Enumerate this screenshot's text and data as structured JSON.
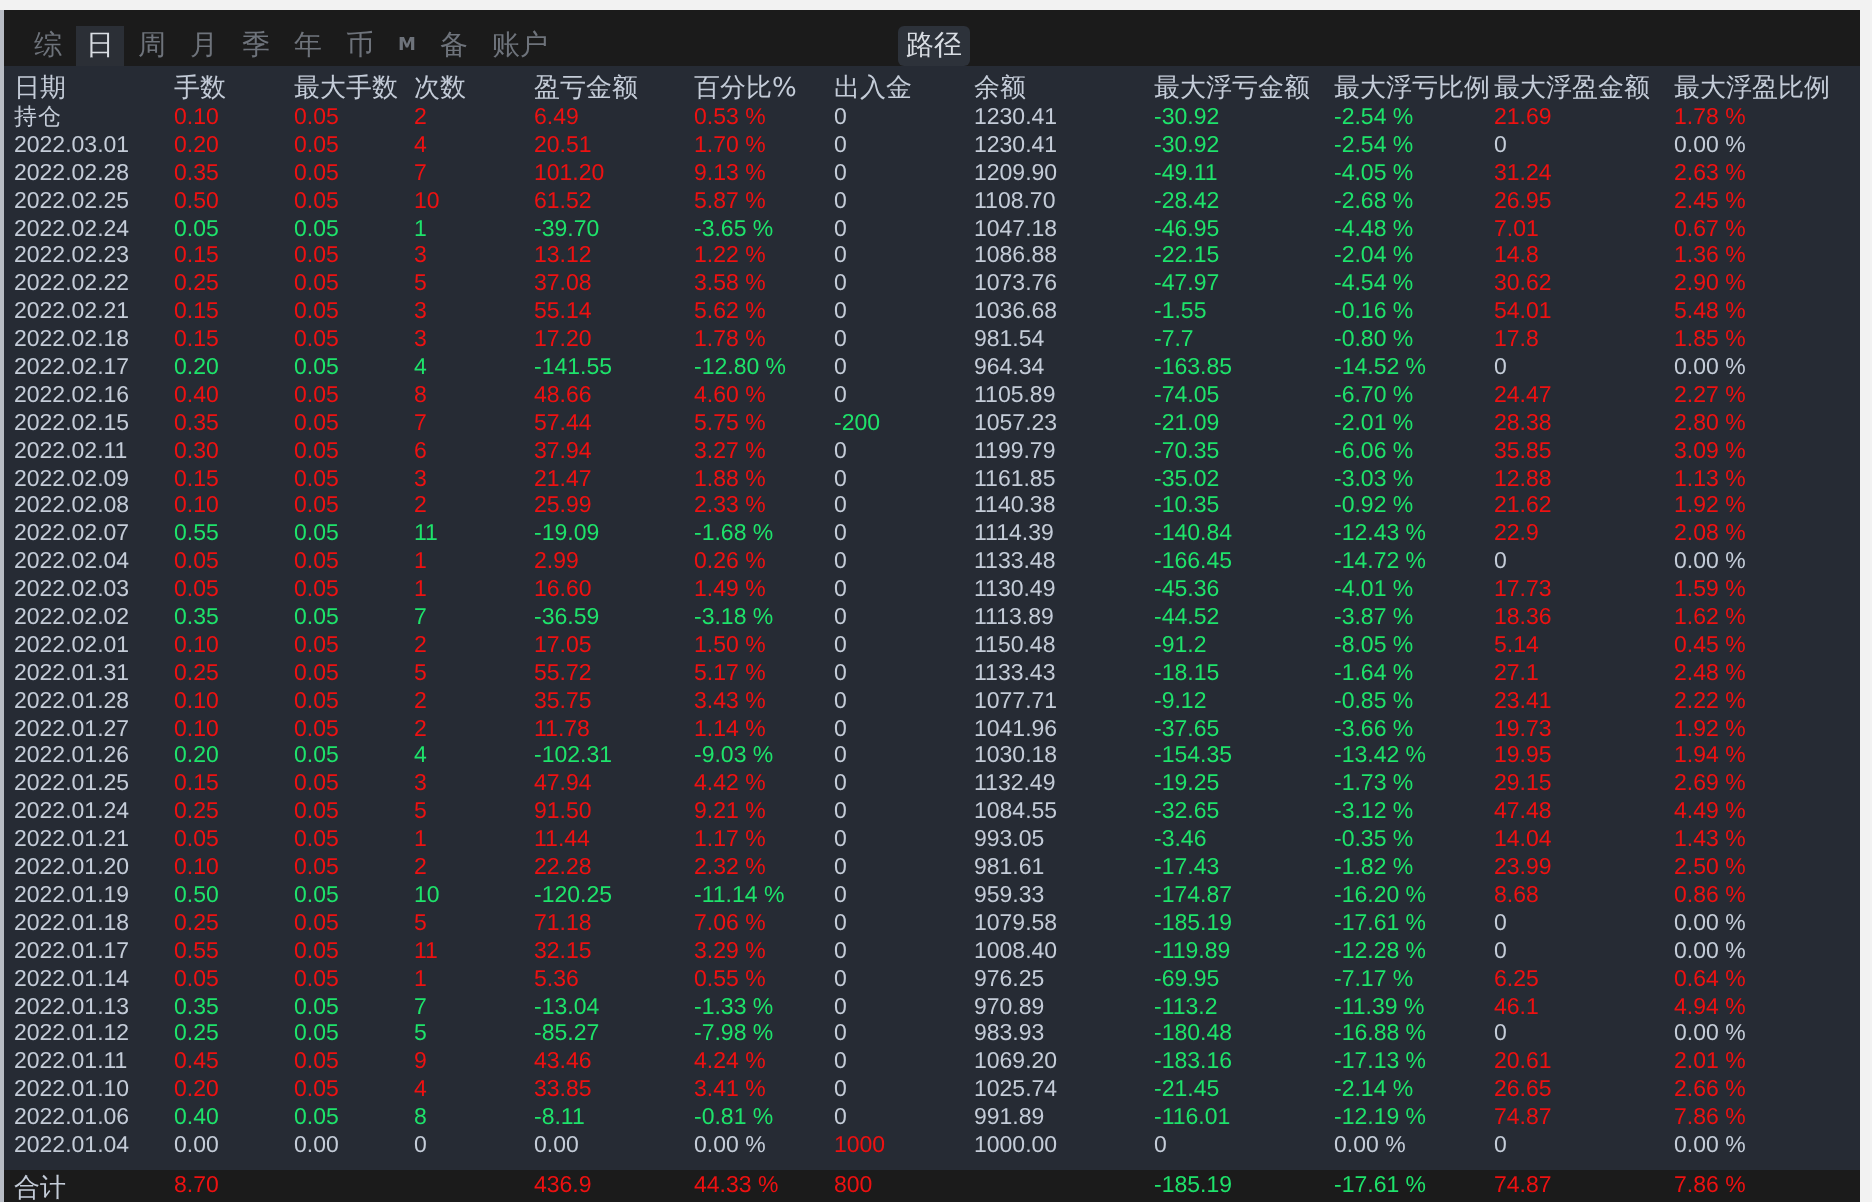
{
  "tabs": [
    {
      "label": "综",
      "selected": false
    },
    {
      "label": "日",
      "selected": true
    },
    {
      "label": "周",
      "selected": false
    },
    {
      "label": "月",
      "selected": false
    },
    {
      "label": "季",
      "selected": false
    },
    {
      "label": "年",
      "selected": false
    },
    {
      "label": "币",
      "selected": false
    },
    {
      "label": "M",
      "selected": false,
      "kind": "small"
    },
    {
      "label": "备",
      "selected": false
    },
    {
      "label": "账户",
      "selected": false
    }
  ],
  "path_button": "路径",
  "table": {
    "columns": [
      "日期",
      "手数",
      "最大手数",
      "次数",
      "盈亏金额",
      "百分比%",
      "出入金",
      "余额",
      "最大浮亏金额",
      "最大浮亏比例",
      "最大浮盈金额",
      "最大浮盈比例"
    ],
    "rows": [
      {
        "cells": [
          "持仓",
          "0.10",
          "0.05",
          "2",
          "6.49",
          "0.53 %",
          "0",
          "1230.41",
          "-30.92",
          "-2.54 %",
          "21.69",
          "1.78 %"
        ],
        "up": true,
        "down": false,
        "inflow": false,
        "outflow": false,
        "drawdown": true,
        "runup": true
      },
      {
        "cells": [
          "2022.03.01",
          "0.20",
          "0.05",
          "4",
          "20.51",
          "1.70 %",
          "0",
          "1230.41",
          "-30.92",
          "-2.54 %",
          "0",
          "0.00 %"
        ],
        "up": true,
        "down": false,
        "inflow": false,
        "outflow": false,
        "drawdown": true,
        "runup": false
      },
      {
        "cells": [
          "2022.02.28",
          "0.35",
          "0.05",
          "7",
          "101.20",
          "9.13 %",
          "0",
          "1209.90",
          "-49.11",
          "-4.05 %",
          "31.24",
          "2.63 %"
        ],
        "up": true,
        "down": false,
        "inflow": false,
        "outflow": false,
        "drawdown": true,
        "runup": true
      },
      {
        "cells": [
          "2022.02.25",
          "0.50",
          "0.05",
          "10",
          "61.52",
          "5.87 %",
          "0",
          "1108.70",
          "-28.42",
          "-2.68 %",
          "26.95",
          "2.45 %"
        ],
        "up": true,
        "down": false,
        "inflow": false,
        "outflow": false,
        "drawdown": true,
        "runup": true
      },
      {
        "cells": [
          "2022.02.24",
          "0.05",
          "0.05",
          "1",
          "-39.70",
          "-3.65 %",
          "0",
          "1047.18",
          "-46.95",
          "-4.48 %",
          "7.01",
          "0.67 %"
        ],
        "up": false,
        "down": true,
        "inflow": false,
        "outflow": false,
        "drawdown": true,
        "runup": true
      },
      {
        "cells": [
          "2022.02.23",
          "0.15",
          "0.05",
          "3",
          "13.12",
          "1.22 %",
          "0",
          "1086.88",
          "-22.15",
          "-2.04 %",
          "14.8",
          "1.36 %"
        ],
        "up": true,
        "down": false,
        "inflow": false,
        "outflow": false,
        "drawdown": true,
        "runup": true
      },
      {
        "cells": [
          "2022.02.22",
          "0.25",
          "0.05",
          "5",
          "37.08",
          "3.58 %",
          "0",
          "1073.76",
          "-47.97",
          "-4.54 %",
          "30.62",
          "2.90 %"
        ],
        "up": true,
        "down": false,
        "inflow": false,
        "outflow": false,
        "drawdown": true,
        "runup": true
      },
      {
        "cells": [
          "2022.02.21",
          "0.15",
          "0.05",
          "3",
          "55.14",
          "5.62 %",
          "0",
          "1036.68",
          "-1.55",
          "-0.16 %",
          "54.01",
          "5.48 %"
        ],
        "up": true,
        "down": false,
        "inflow": false,
        "outflow": false,
        "drawdown": true,
        "runup": true
      },
      {
        "cells": [
          "2022.02.18",
          "0.15",
          "0.05",
          "3",
          "17.20",
          "1.78 %",
          "0",
          "981.54",
          "-7.7",
          "-0.80 %",
          "17.8",
          "1.85 %"
        ],
        "up": true,
        "down": false,
        "inflow": false,
        "outflow": false,
        "drawdown": true,
        "runup": true
      },
      {
        "cells": [
          "2022.02.17",
          "0.20",
          "0.05",
          "4",
          "-141.55",
          "-12.80 %",
          "0",
          "964.34",
          "-163.85",
          "-14.52 %",
          "0",
          "0.00 %"
        ],
        "up": false,
        "down": true,
        "inflow": false,
        "outflow": false,
        "drawdown": true,
        "runup": false
      },
      {
        "cells": [
          "2022.02.16",
          "0.40",
          "0.05",
          "8",
          "48.66",
          "4.60 %",
          "0",
          "1105.89",
          "-74.05",
          "-6.70 %",
          "24.47",
          "2.27 %"
        ],
        "up": true,
        "down": false,
        "inflow": false,
        "outflow": false,
        "drawdown": true,
        "runup": true
      },
      {
        "cells": [
          "2022.02.15",
          "0.35",
          "0.05",
          "7",
          "57.44",
          "5.75 %",
          "-200",
          "1057.23",
          "-21.09",
          "-2.01 %",
          "28.38",
          "2.80 %"
        ],
        "up": true,
        "down": false,
        "inflow": false,
        "outflow": true,
        "drawdown": true,
        "runup": true
      },
      {
        "cells": [
          "2022.02.11",
          "0.30",
          "0.05",
          "6",
          "37.94",
          "3.27 %",
          "0",
          "1199.79",
          "-70.35",
          "-6.06 %",
          "35.85",
          "3.09 %"
        ],
        "up": true,
        "down": false,
        "inflow": false,
        "outflow": false,
        "drawdown": true,
        "runup": true
      },
      {
        "cells": [
          "2022.02.09",
          "0.15",
          "0.05",
          "3",
          "21.47",
          "1.88 %",
          "0",
          "1161.85",
          "-35.02",
          "-3.03 %",
          "12.88",
          "1.13 %"
        ],
        "up": true,
        "down": false,
        "inflow": false,
        "outflow": false,
        "drawdown": true,
        "runup": true
      },
      {
        "cells": [
          "2022.02.08",
          "0.10",
          "0.05",
          "2",
          "25.99",
          "2.33 %",
          "0",
          "1140.38",
          "-10.35",
          "-0.92 %",
          "21.62",
          "1.92 %"
        ],
        "up": true,
        "down": false,
        "inflow": false,
        "outflow": false,
        "drawdown": true,
        "runup": true
      },
      {
        "cells": [
          "2022.02.07",
          "0.55",
          "0.05",
          "11",
          "-19.09",
          "-1.68 %",
          "0",
          "1114.39",
          "-140.84",
          "-12.43 %",
          "22.9",
          "2.08 %"
        ],
        "up": false,
        "down": true,
        "inflow": false,
        "outflow": false,
        "drawdown": true,
        "runup": true
      },
      {
        "cells": [
          "2022.02.04",
          "0.05",
          "0.05",
          "1",
          "2.99",
          "0.26 %",
          "0",
          "1133.48",
          "-166.45",
          "-14.72 %",
          "0",
          "0.00 %"
        ],
        "up": true,
        "down": false,
        "inflow": false,
        "outflow": false,
        "drawdown": true,
        "runup": false
      },
      {
        "cells": [
          "2022.02.03",
          "0.05",
          "0.05",
          "1",
          "16.60",
          "1.49 %",
          "0",
          "1130.49",
          "-45.36",
          "-4.01 %",
          "17.73",
          "1.59 %"
        ],
        "up": true,
        "down": false,
        "inflow": false,
        "outflow": false,
        "drawdown": true,
        "runup": true
      },
      {
        "cells": [
          "2022.02.02",
          "0.35",
          "0.05",
          "7",
          "-36.59",
          "-3.18 %",
          "0",
          "1113.89",
          "-44.52",
          "-3.87 %",
          "18.36",
          "1.62 %"
        ],
        "up": false,
        "down": true,
        "inflow": false,
        "outflow": false,
        "drawdown": true,
        "runup": true
      },
      {
        "cells": [
          "2022.02.01",
          "0.10",
          "0.05",
          "2",
          "17.05",
          "1.50 %",
          "0",
          "1150.48",
          "-91.2",
          "-8.05 %",
          "5.14",
          "0.45 %"
        ],
        "up": true,
        "down": false,
        "inflow": false,
        "outflow": false,
        "drawdown": true,
        "runup": true
      },
      {
        "cells": [
          "2022.01.31",
          "0.25",
          "0.05",
          "5",
          "55.72",
          "5.17 %",
          "0",
          "1133.43",
          "-18.15",
          "-1.64 %",
          "27.1",
          "2.48 %"
        ],
        "up": true,
        "down": false,
        "inflow": false,
        "outflow": false,
        "drawdown": true,
        "runup": true
      },
      {
        "cells": [
          "2022.01.28",
          "0.10",
          "0.05",
          "2",
          "35.75",
          "3.43 %",
          "0",
          "1077.71",
          "-9.12",
          "-0.85 %",
          "23.41",
          "2.22 %"
        ],
        "up": true,
        "down": false,
        "inflow": false,
        "outflow": false,
        "drawdown": true,
        "runup": true
      },
      {
        "cells": [
          "2022.01.27",
          "0.10",
          "0.05",
          "2",
          "11.78",
          "1.14 %",
          "0",
          "1041.96",
          "-37.65",
          "-3.66 %",
          "19.73",
          "1.92 %"
        ],
        "up": true,
        "down": false,
        "inflow": false,
        "outflow": false,
        "drawdown": true,
        "runup": true
      },
      {
        "cells": [
          "2022.01.26",
          "0.20",
          "0.05",
          "4",
          "-102.31",
          "-9.03 %",
          "0",
          "1030.18",
          "-154.35",
          "-13.42 %",
          "19.95",
          "1.94 %"
        ],
        "up": false,
        "down": true,
        "inflow": false,
        "outflow": false,
        "drawdown": true,
        "runup": true
      },
      {
        "cells": [
          "2022.01.25",
          "0.15",
          "0.05",
          "3",
          "47.94",
          "4.42 %",
          "0",
          "1132.49",
          "-19.25",
          "-1.73 %",
          "29.15",
          "2.69 %"
        ],
        "up": true,
        "down": false,
        "inflow": false,
        "outflow": false,
        "drawdown": true,
        "runup": true
      },
      {
        "cells": [
          "2022.01.24",
          "0.25",
          "0.05",
          "5",
          "91.50",
          "9.21 %",
          "0",
          "1084.55",
          "-32.65",
          "-3.12 %",
          "47.48",
          "4.49 %"
        ],
        "up": true,
        "down": false,
        "inflow": false,
        "outflow": false,
        "drawdown": true,
        "runup": true
      },
      {
        "cells": [
          "2022.01.21",
          "0.05",
          "0.05",
          "1",
          "11.44",
          "1.17 %",
          "0",
          "993.05",
          "-3.46",
          "-0.35 %",
          "14.04",
          "1.43 %"
        ],
        "up": true,
        "down": false,
        "inflow": false,
        "outflow": false,
        "drawdown": true,
        "runup": true
      },
      {
        "cells": [
          "2022.01.20",
          "0.10",
          "0.05",
          "2",
          "22.28",
          "2.32 %",
          "0",
          "981.61",
          "-17.43",
          "-1.82 %",
          "23.99",
          "2.50 %"
        ],
        "up": true,
        "down": false,
        "inflow": false,
        "outflow": false,
        "drawdown": true,
        "runup": true
      },
      {
        "cells": [
          "2022.01.19",
          "0.50",
          "0.05",
          "10",
          "-120.25",
          "-11.14 %",
          "0",
          "959.33",
          "-174.87",
          "-16.20 %",
          "8.68",
          "0.86 %"
        ],
        "up": false,
        "down": true,
        "inflow": false,
        "outflow": false,
        "drawdown": true,
        "runup": true
      },
      {
        "cells": [
          "2022.01.18",
          "0.25",
          "0.05",
          "5",
          "71.18",
          "7.06 %",
          "0",
          "1079.58",
          "-185.19",
          "-17.61 %",
          "0",
          "0.00 %"
        ],
        "up": true,
        "down": false,
        "inflow": false,
        "outflow": false,
        "drawdown": true,
        "runup": false
      },
      {
        "cells": [
          "2022.01.17",
          "0.55",
          "0.05",
          "11",
          "32.15",
          "3.29 %",
          "0",
          "1008.40",
          "-119.89",
          "-12.28 %",
          "0",
          "0.00 %"
        ],
        "up": true,
        "down": false,
        "inflow": false,
        "outflow": false,
        "drawdown": true,
        "runup": false
      },
      {
        "cells": [
          "2022.01.14",
          "0.05",
          "0.05",
          "1",
          "5.36",
          "0.55 %",
          "0",
          "976.25",
          "-69.95",
          "-7.17 %",
          "6.25",
          "0.64 %"
        ],
        "up": true,
        "down": false,
        "inflow": false,
        "outflow": false,
        "drawdown": true,
        "runup": true
      },
      {
        "cells": [
          "2022.01.13",
          "0.35",
          "0.05",
          "7",
          "-13.04",
          "-1.33 %",
          "0",
          "970.89",
          "-113.2",
          "-11.39 %",
          "46.1",
          "4.94 %"
        ],
        "up": false,
        "down": true,
        "inflow": false,
        "outflow": false,
        "drawdown": true,
        "runup": true
      },
      {
        "cells": [
          "2022.01.12",
          "0.25",
          "0.05",
          "5",
          "-85.27",
          "-7.98 %",
          "0",
          "983.93",
          "-180.48",
          "-16.88 %",
          "0",
          "0.00 %"
        ],
        "up": false,
        "down": true,
        "inflow": false,
        "outflow": false,
        "drawdown": true,
        "runup": false
      },
      {
        "cells": [
          "2022.01.11",
          "0.45",
          "0.05",
          "9",
          "43.46",
          "4.24 %",
          "0",
          "1069.20",
          "-183.16",
          "-17.13 %",
          "20.61",
          "2.01 %"
        ],
        "up": true,
        "down": false,
        "inflow": false,
        "outflow": false,
        "drawdown": true,
        "runup": true
      },
      {
        "cells": [
          "2022.01.10",
          "0.20",
          "0.05",
          "4",
          "33.85",
          "3.41 %",
          "0",
          "1025.74",
          "-21.45",
          "-2.14 %",
          "26.65",
          "2.66 %"
        ],
        "up": true,
        "down": false,
        "inflow": false,
        "outflow": false,
        "drawdown": true,
        "runup": true
      },
      {
        "cells": [
          "2022.01.06",
          "0.40",
          "0.05",
          "8",
          "-8.11",
          "-0.81 %",
          "0",
          "991.89",
          "-116.01",
          "-12.19 %",
          "74.87",
          "7.86 %"
        ],
        "up": false,
        "down": true,
        "inflow": false,
        "outflow": false,
        "drawdown": true,
        "runup": true
      },
      {
        "cells": [
          "2022.01.04",
          "0.00",
          "0.00",
          "0",
          "0.00",
          "0.00 %",
          "1000",
          "1000.00",
          "0",
          "0.00 %",
          "0",
          "0.00 %"
        ],
        "up": false,
        "down": false,
        "inflow": true,
        "outflow": false,
        "drawdown": false,
        "runup": false
      }
    ],
    "total": {
      "cells": [
        "合计",
        "8.70",
        "",
        "",
        "436.9",
        "44.33 %",
        "800",
        "",
        "-185.19",
        "-17.61 %",
        "74.87",
        "7.86 %"
      ],
      "up": true,
      "down": false,
      "inflow": true,
      "outflow": false,
      "drawdown": true,
      "runup": true
    }
  }
}
